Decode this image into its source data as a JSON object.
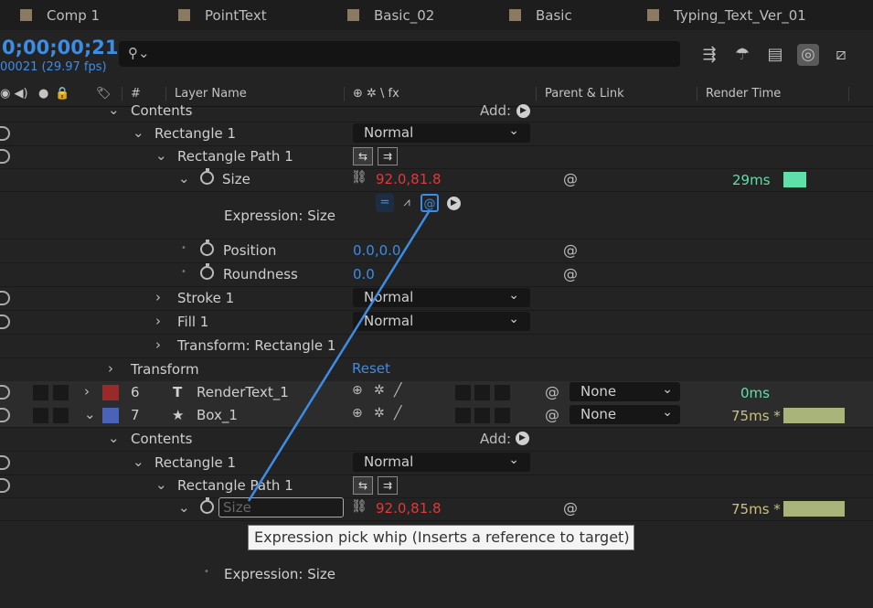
{
  "tabs": [
    {
      "label": "Comp 1"
    },
    {
      "label": "PointText"
    },
    {
      "label": "Basic_02"
    },
    {
      "label": "Basic"
    },
    {
      "label": "Typing_Text_Ver_01"
    }
  ],
  "timecode": "0;00;00;21",
  "fps": "00021 (29.97 fps)",
  "search": {
    "placeholder": ""
  },
  "toolbar_icons": [
    "composition-flowchart-icon",
    "draft-3d-icon",
    "frame-blending-icon",
    "motion-blur-icon",
    "graph-editor-icon"
  ],
  "columns": {
    "num": "#",
    "layer_name": "Layer Name",
    "switches": "⊕ ✲ \\ fx",
    "parent": "Parent & Link",
    "render_time": "Render Time"
  },
  "rows": {
    "contents_1": "Contents",
    "add_label": "Add:",
    "rect1_a": "Rectangle 1",
    "rect1_a_mode": "Normal",
    "rectpath1_a": "Rectangle Path 1",
    "size_a": "Size",
    "size_a_value": "92.0,81.8",
    "size_a_ms": "29ms",
    "expression_a": "Expression: Size",
    "position": "Position",
    "position_value": "0.0,0.0",
    "roundness": "Roundness",
    "roundness_value": "0.0",
    "stroke1": "Stroke 1",
    "stroke1_mode": "Normal",
    "fill1": "Fill 1",
    "fill1_mode": "Normal",
    "transform_rect": "Transform: Rectangle 1",
    "transform": "Transform",
    "reset": "Reset",
    "layer6_num": "6",
    "layer6_name": "RenderText_1",
    "layer6_parent": "None",
    "layer6_ms": "0ms",
    "layer7_num": "7",
    "layer7_name": "Box_1",
    "layer7_parent": "None",
    "layer7_ms": "75ms *",
    "contents_2": "Contents",
    "rect1_b": "Rectangle 1",
    "rect1_b_mode": "Normal",
    "rectpath1_b": "Rectangle Path 1",
    "size_b_input": "Size",
    "size_b_value": "92.0,81.8",
    "size_b_ms": "75ms *",
    "expression_b": "Expression: Size"
  },
  "tooltip": "Expression pick whip (Inserts a reference to target)",
  "colors": {
    "accent_blue": "#3d8ce6",
    "value_red": "#e0383c",
    "render_green": "#5fe0a8",
    "render_olive": "#a8b47a",
    "layer6_label": "#9a2a2a",
    "layer7_label": "#4a62b8"
  }
}
